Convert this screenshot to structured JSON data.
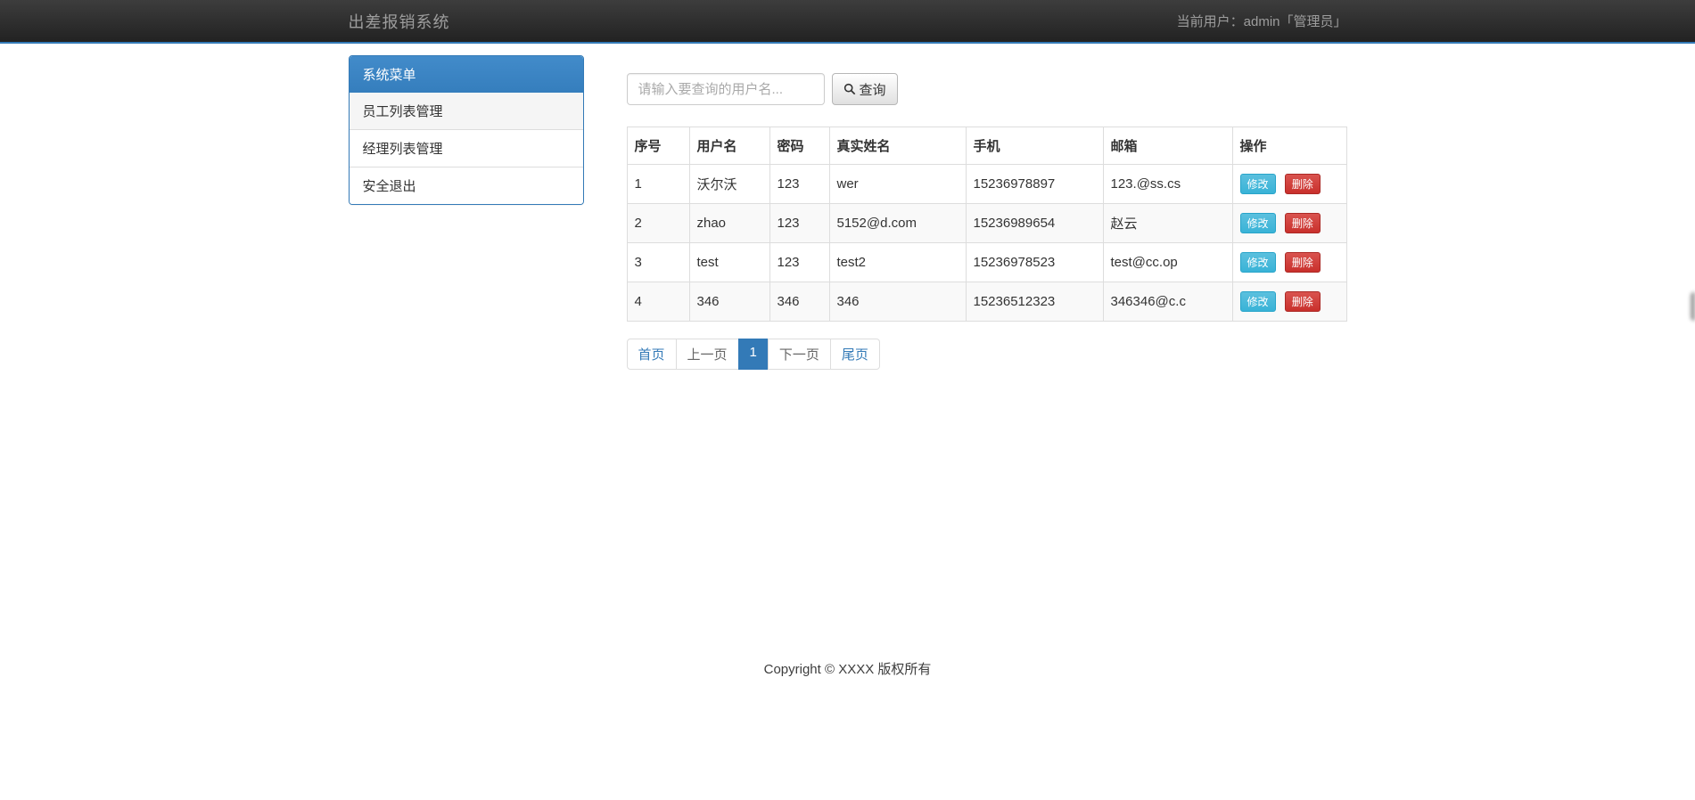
{
  "navbar": {
    "brand": "出差报销系统",
    "user_label": "当前用户：admin「管理员」"
  },
  "sidebar": {
    "title": "系统菜单",
    "items": [
      {
        "label": "员工列表管理",
        "state": "active"
      },
      {
        "label": "经理列表管理",
        "state": ""
      },
      {
        "label": "安全退出",
        "state": ""
      }
    ]
  },
  "search": {
    "placeholder": "请输入要查询的用户名...",
    "button_label": "查询"
  },
  "table": {
    "headers": [
      "序号",
      "用户名",
      "密码",
      "真实姓名",
      "手机",
      "邮箱",
      "操作"
    ],
    "rows": [
      {
        "no": "1",
        "username": "沃尔沃",
        "password": "123",
        "realname": "wer",
        "phone": "15236978897",
        "email": "123.@ss.cs"
      },
      {
        "no": "2",
        "username": "zhao",
        "password": "123",
        "realname": "5152@d.com",
        "phone": "15236989654",
        "email": "赵云"
      },
      {
        "no": "3",
        "username": "test",
        "password": "123",
        "realname": "test2",
        "phone": "15236978523",
        "email": "test@cc.op"
      },
      {
        "no": "4",
        "username": "346",
        "password": "346",
        "realname": "346",
        "phone": "15236512323",
        "email": "346346@c.c"
      }
    ],
    "actions": {
      "edit": "修改",
      "delete": "删除"
    }
  },
  "pagination": {
    "items": [
      {
        "label": "首页",
        "type": "link"
      },
      {
        "label": "上一页",
        "type": "disabled"
      },
      {
        "label": "1",
        "type": "active"
      },
      {
        "label": "下一页",
        "type": "disabled"
      },
      {
        "label": "尾页",
        "type": "link"
      }
    ]
  },
  "footer": {
    "copyright": "Copyright © XXXX 版权所有"
  },
  "colors": {
    "accent": "#337ab7",
    "panel_header_top": "#428bca",
    "panel_header_bottom": "#357ebd",
    "navbar_top": "#3d3d3d",
    "navbar_bottom": "#222222",
    "edit_button": "#5bc0de",
    "delete_button": "#d9534f",
    "stripe_row": "#f9f9f9"
  }
}
